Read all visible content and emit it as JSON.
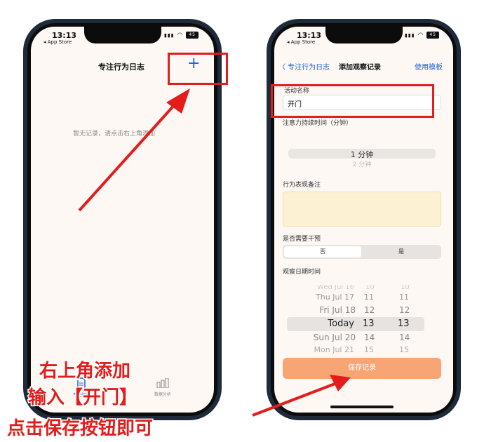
{
  "left_screen": {
    "status": {
      "time": "13:13",
      "back_label": "◂ App Store",
      "signal": "▮▮▮",
      "wifi": "◠",
      "battery": "45"
    },
    "nav": {
      "title": "专注行为日志",
      "add_label": "+"
    },
    "empty_message": "暂无记录，请点击右上角添加",
    "tabbar": {
      "tab1_label": "专注行为",
      "tab2_label": "数据分析"
    }
  },
  "right_screen": {
    "status": {
      "time": "13:13",
      "back_label": "◂ App Store",
      "signal": "▮▮▮",
      "wifi": "◠",
      "battery": "45"
    },
    "nav": {
      "back_label": "〈 专注行为日志",
      "title": "添加观察记录",
      "template_label": "使用模板"
    },
    "form": {
      "activity_name_label": "活动名称",
      "activity_name_value": "开门",
      "duration_label": "注意力持续时间（分钟）",
      "duration_selected": "1 分钟",
      "duration_next": "2 分钟",
      "notes_label": "行为表现备注",
      "intervention_label": "是否需要干预",
      "intervention_no": "否",
      "intervention_yes": "是",
      "date_label": "观察日期时间",
      "date_picker": {
        "rows": [
          {
            "date": "Wed Jul 16",
            "hour": "10",
            "minute": "10"
          },
          {
            "date": "Thu Jul 17",
            "hour": "11",
            "minute": "11"
          },
          {
            "date": "Fri Jul 18",
            "hour": "12",
            "minute": "12"
          },
          {
            "date": "Today",
            "hour": "13",
            "minute": "13"
          },
          {
            "date": "Sun Jul 20",
            "hour": "14",
            "minute": "14"
          },
          {
            "date": "Mon Jul 21",
            "hour": "15",
            "minute": "15"
          }
        ]
      },
      "save_label": "保存记录"
    }
  },
  "annotations": {
    "line1": "右上角添加",
    "line2": "输入【开门】",
    "line3": "点击保存按钮即可"
  },
  "colors": {
    "accent_red": "#e31c1c",
    "link_blue": "#1e63d6",
    "save_orange": "#f7a574",
    "screen_bg": "#fdf8f3"
  }
}
